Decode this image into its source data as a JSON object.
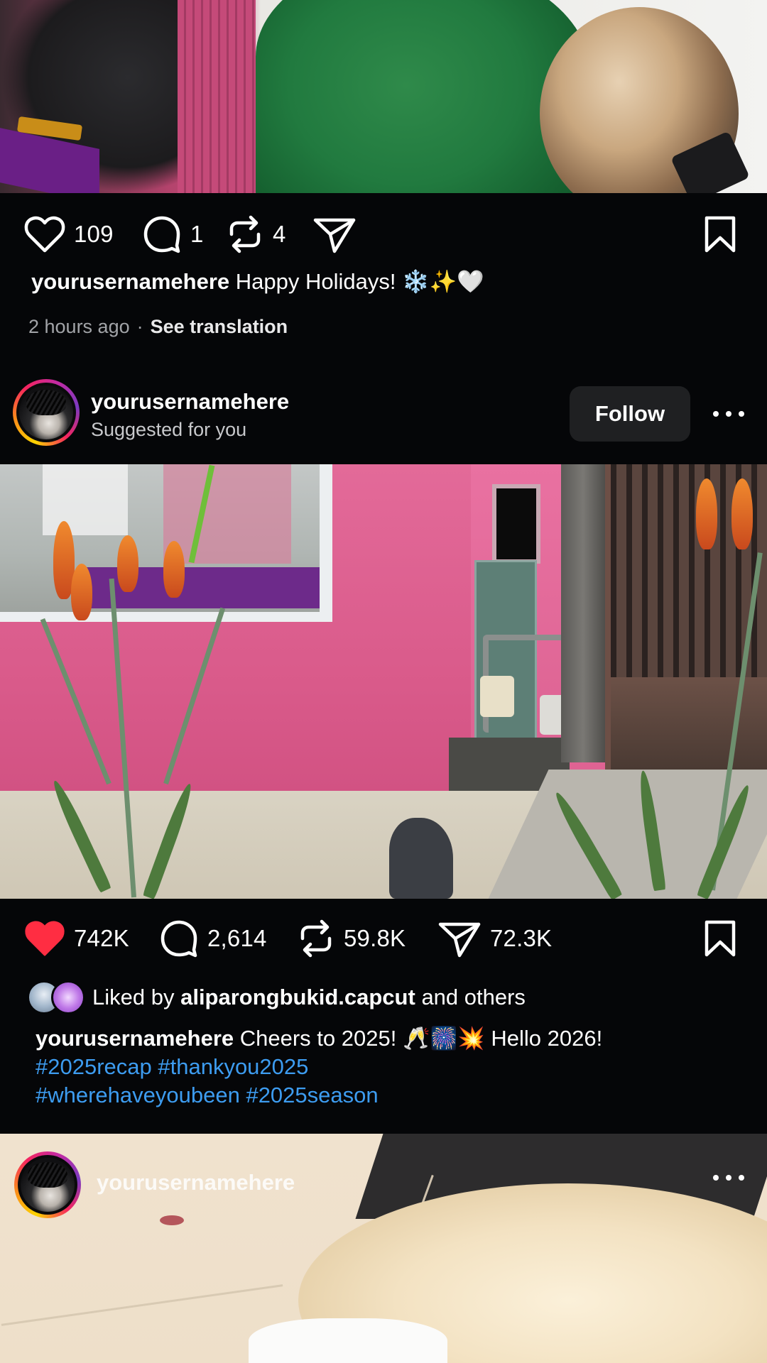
{
  "post1": {
    "actions": {
      "likes": "109",
      "comments": "1",
      "reposts": "4"
    },
    "caption": {
      "username": "yourusernamehere",
      "text": "Happy Holidays! ❄️✨🤍"
    },
    "time_ago": "2 hours ago",
    "separator": "·",
    "see_translation": "See translation"
  },
  "post2": {
    "header": {
      "username": "yourusernamehere",
      "subtitle": "Suggested for you",
      "follow_label": "Follow"
    },
    "actions": {
      "likes": "742K",
      "comments": "2,614",
      "reposts": "59.8K",
      "shares": "72.3K",
      "liked": true,
      "like_color": "#ff2d42"
    },
    "liked_by": {
      "prefix": "Liked by",
      "username": "aliparongbukid.capcut",
      "suffix": "and others"
    },
    "caption": {
      "username": "yourusernamehere",
      "text": "Cheers to 2025! 🥂🎆💥 Hello 2026!",
      "hashtags_line1": "#2025recap #thankyou2025",
      "hashtags_line2": "#wherehaveyoubeen #2025season"
    }
  },
  "post3": {
    "header": {
      "username": "yourusernamehere"
    }
  },
  "colors": {
    "background": "#050608",
    "hashtag": "#3d9cf0",
    "muted_text": "#a2a4a8",
    "follow_button_bg": "#1f2022"
  },
  "icons": {
    "like": "heart-icon",
    "comment": "comment-bubble-icon",
    "repost": "repost-icon",
    "share": "send-icon",
    "save": "bookmark-icon",
    "more": "more-dots-icon"
  }
}
